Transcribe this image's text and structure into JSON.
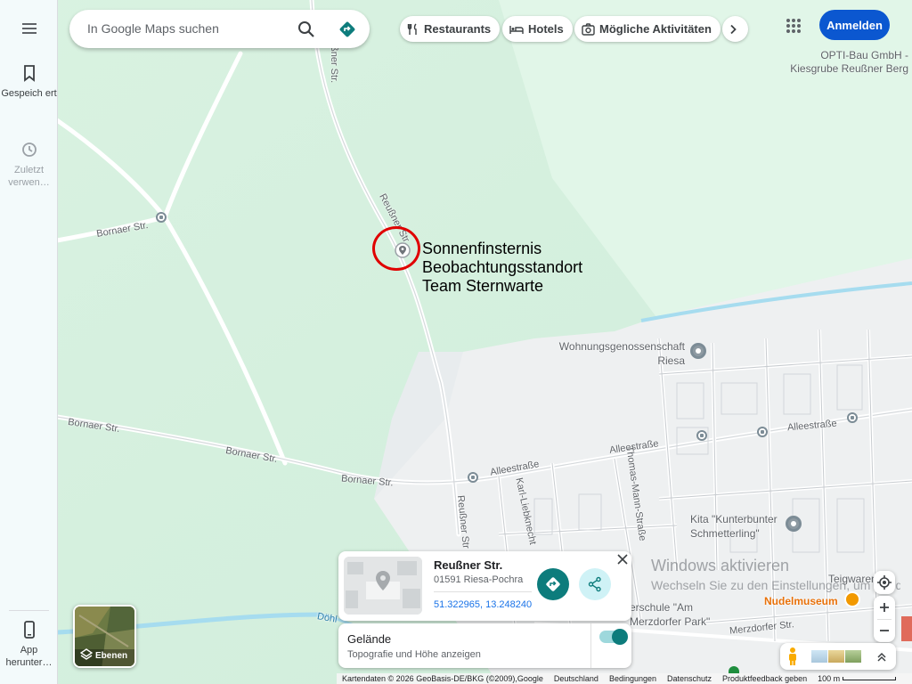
{
  "search": {
    "placeholder": "In Google Maps suchen"
  },
  "chips": [
    {
      "label": "Restaurants",
      "icon": "fork-knife-icon"
    },
    {
      "label": "Hotels",
      "icon": "bed-icon"
    },
    {
      "label": "Mögliche Aktivitäten",
      "icon": "camera-icon"
    }
  ],
  "header": {
    "signin_label": "Anmelden"
  },
  "rail": {
    "saved_label": "Gespeich ert",
    "recent_label": "Zuletzt verwen…",
    "app_label": "App herunter…"
  },
  "annotation": {
    "line1": "Sonnenfinsternis",
    "line2": "Beobachtungsstandort",
    "line3": "Team Sternwarte",
    "circle_color": "#e00000"
  },
  "map_labels": {
    "business": "OPTI-Bau GmbH - Kiesgrube Reußner Berg",
    "reussner_str_top": "Reußner Str.",
    "reussner_str_mid": "Reußner Str.",
    "reussner_str_bottom": "Reußner Str",
    "bornaer_str_1": "Bornaer Str.",
    "bornaer_str_2": "Bornaer Str.",
    "bornaer_str_3": "Bornaer Str.",
    "bornaer_str_4": "Bornaer Str.",
    "alleestrasse_1": "Alleestraße",
    "alleestrasse_2": "Alleestraße",
    "alleestrasse_3": "Alleestraße",
    "karl_liebknecht": "Karl-Liebknecht",
    "thomas_mann": "Thomas-Mann-Straße",
    "merzdorfer_str": "Merzdorfer Str.",
    "doehl": "Döhl",
    "merzdorfer_park": "erschule \"Am Merzdorfer Park\"",
    "poi_wohnung": "Wohnungsgenossenschaft Riesa",
    "poi_kita": "Kita \"Kunterbunter Schmetterling\"",
    "poi_teigwaren": "Teigwaren Ri",
    "poi_nudelmuseum": "Nudelmuseum"
  },
  "place_card": {
    "name": "Reußner Str.",
    "address": "01591 Riesa-Pochra",
    "coords": "51.322965, 13.248240"
  },
  "terrain_card": {
    "title": "Gelände",
    "subtitle": "Topografie und Höhe anzeigen",
    "enabled": true
  },
  "layers": {
    "label": "Ebenen"
  },
  "watermark": {
    "title": "Windows aktivieren",
    "subtitle": "Wechseln Sie zu den Einstellungen, um Windows zu aktivieren."
  },
  "footer": {
    "attribution": "Kartendaten © 2026 GeoBasis-DE/BKG (©2009),Google",
    "country": "Deutschland",
    "terms": "Bedingungen",
    "privacy": "Datenschutz",
    "feedback": "Produktfeedback geben",
    "scale": "100 m"
  },
  "colors": {
    "accent": "#0b57d0",
    "teal": "#0d7c7c",
    "map_green": "#dff3e6",
    "urban": "#eef0f1"
  }
}
